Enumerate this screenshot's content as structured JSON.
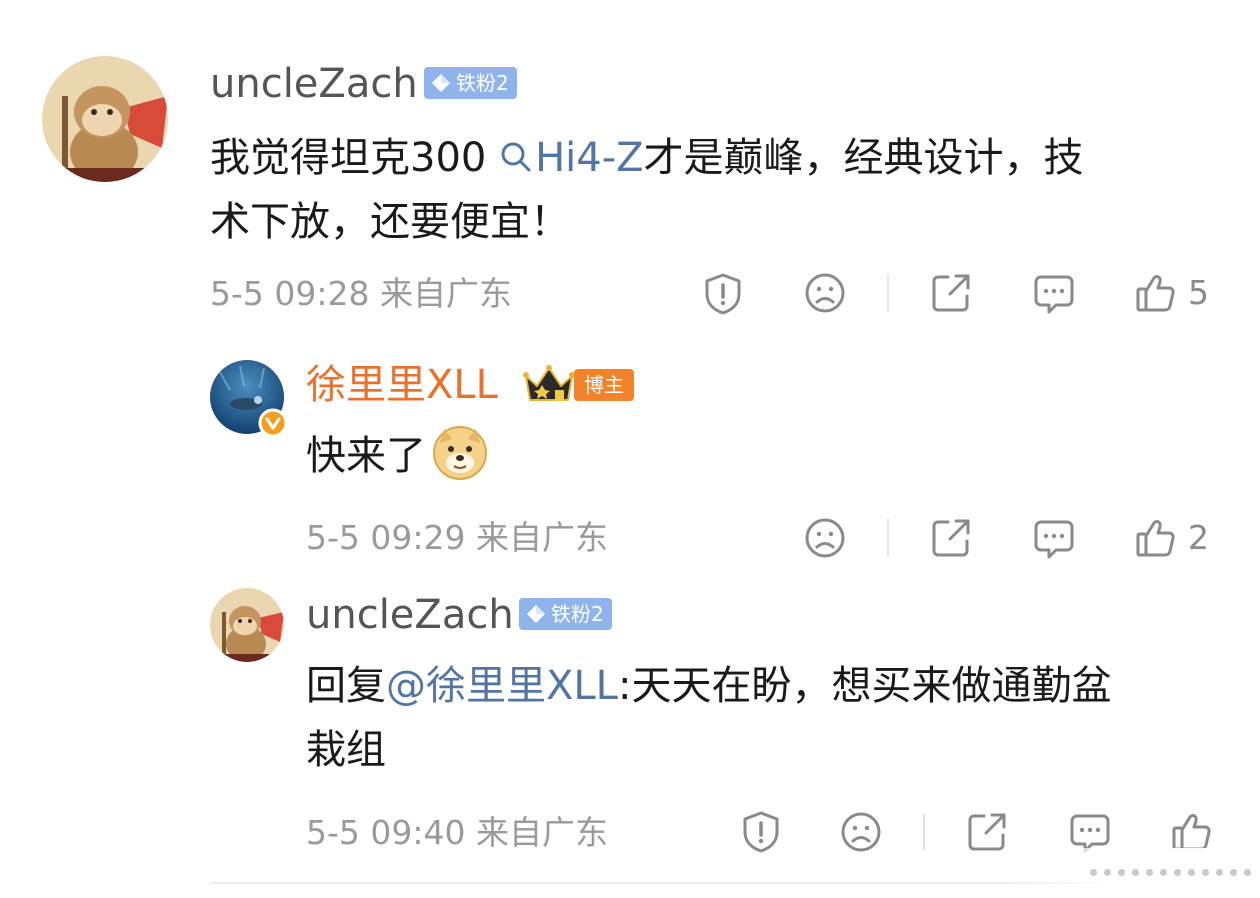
{
  "comments": [
    {
      "user": "uncleZach",
      "badge": "铁粉2",
      "text_before": "我觉得坦克300 ",
      "topic": "Hi4-Z",
      "text_after": "才是巅峰，经典设计，技",
      "text_line2": "术下放，还要便宜！",
      "time": "5-5 09:28",
      "location": "来自广东",
      "likes": "5"
    },
    {
      "user": "徐里里XLL",
      "badge": "博主",
      "text": "快来了",
      "time": "5-5 09:29",
      "location": "来自广东",
      "likes": "2"
    },
    {
      "user": "uncleZach",
      "badge": "铁粉2",
      "reply_prefix": "回复",
      "mention": "@徐里里XLL",
      "text_after": ":天天在盼，想买来做通勤盆",
      "text_line2": "栽组",
      "time": "5-5 09:40",
      "location": "来自广东"
    }
  ],
  "colors": {
    "badge_fan": "#8fb4ec",
    "badge_blogger": "#f2832a",
    "vip_name": "#e8722c",
    "link": "#5276a4"
  },
  "icons": [
    "report-icon",
    "dislike-face-icon",
    "share-icon",
    "comment-icon",
    "like-thumb-icon",
    "search-topic-icon",
    "verified-v-icon",
    "crown-icon",
    "doge-emoji"
  ]
}
